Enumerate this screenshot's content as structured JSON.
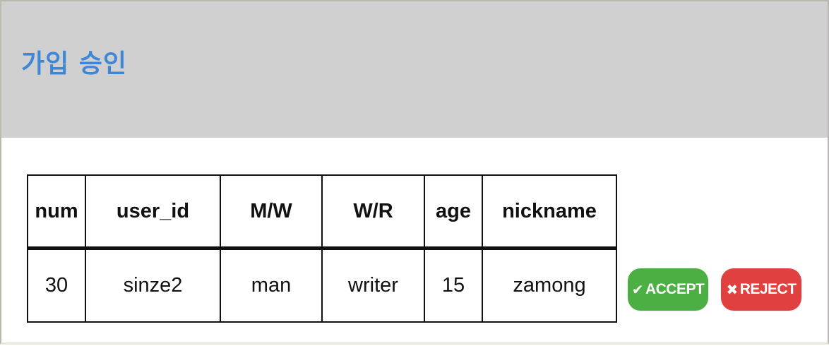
{
  "header": {
    "title": "가입 승인"
  },
  "table": {
    "columns": [
      "num",
      "user_id",
      "M/W",
      "W/R",
      "age",
      "nickname"
    ],
    "rows": [
      [
        "30",
        "sinze2",
        "man",
        "writer",
        "15",
        "zamong"
      ]
    ]
  },
  "actions": {
    "accept_label": "ACCEPT",
    "accept_icon": "✔",
    "reject_label": "REJECT",
    "reject_icon": "✖"
  },
  "colors": {
    "header_background": "#d0d0d0",
    "title": "#3f87d6",
    "accept": "#4caf44",
    "reject": "#e0413f"
  }
}
